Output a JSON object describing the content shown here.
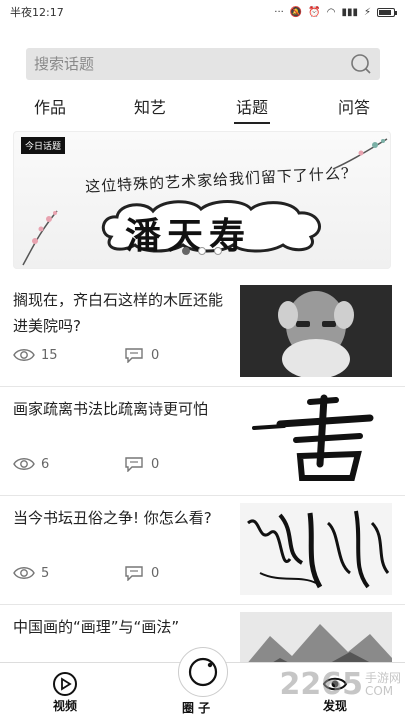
{
  "status": {
    "time": "半夜12:17",
    "battery_level": 0.85
  },
  "search": {
    "placeholder": "搜索话题"
  },
  "tabs": [
    {
      "label": "作品"
    },
    {
      "label": "知艺"
    },
    {
      "label": "话题"
    },
    {
      "label": "问答"
    }
  ],
  "active_tab": "话题",
  "banner": {
    "tag": "今日话题",
    "subtitle": "这位特殊的艺术家给我们留下了什么?",
    "title": "潘天寿",
    "active_dot": 1,
    "dots": 3
  },
  "items": [
    {
      "title": "搁现在，齐白石这样的木匠还能进美院吗?",
      "views": "15",
      "comments": "0",
      "thumb": "portrait"
    },
    {
      "title": "画家疏离书法比疏离诗更可怕",
      "views": "6",
      "comments": "0",
      "thumb": "calligraphy"
    },
    {
      "title": "当今书坛丑俗之争! 你怎么看?",
      "views": "5",
      "comments": "0",
      "thumb": "cursive"
    },
    {
      "title": "中国画的“画理”与“画法”",
      "views": "",
      "comments": "",
      "thumb": "landscape"
    }
  ],
  "bottom_nav": {
    "left": "视频",
    "center": "圈 子",
    "right": "发现"
  },
  "watermark": {
    "brand": "2265",
    "line1": "手游网",
    "line2": "COM"
  },
  "colors": {
    "accent": "#222222",
    "search_bg": "#e4e4e4"
  }
}
